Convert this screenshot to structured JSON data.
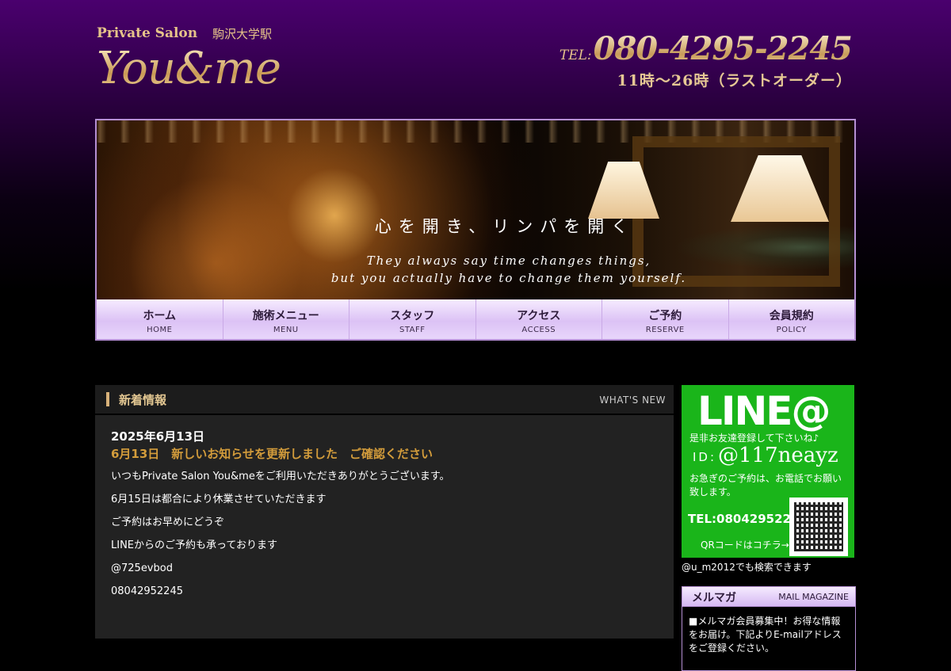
{
  "header": {
    "logo_small": "Private Salon",
    "logo_station": "駒沢大学駅",
    "logo_brand": "You&me",
    "tel_label": "TEL:",
    "tel_number": "080-4295-2245",
    "hours": "11時〜26時（ラストオーダー）"
  },
  "hero": {
    "headline": "心を開き、リンパを開く",
    "tagline_line1": "They always say time changes things,",
    "tagline_line2": "but you actually have to change them yourself."
  },
  "nav": [
    {
      "jp": "ホーム",
      "en": "HOME"
    },
    {
      "jp": "施術メニュー",
      "en": "MENU"
    },
    {
      "jp": "スタッフ",
      "en": "STAFF"
    },
    {
      "jp": "アクセス",
      "en": "ACCESS"
    },
    {
      "jp": "ご予約",
      "en": "RESERVE"
    },
    {
      "jp": "会員規約",
      "en": "POLICY"
    }
  ],
  "news": {
    "heading": "新着情報",
    "heading_en": "WHAT'S NEW",
    "date": "2025年6月13日",
    "title": "6月13日　新しいお知らせを更新しました　ご確認ください",
    "paragraphs": [
      "いつもPrivate Salon You&meをご利用いただきありがとうございます。",
      "6月15日は都合により休業させていただきます",
      "ご予約はお早めにどうぞ",
      "LINEからのご予約も承っております",
      "@725evbod",
      "08042952245"
    ]
  },
  "sidebar": {
    "line_logo": "LINE@",
    "line_sub": "是非お友達登録して下さいね♪",
    "line_id_label": "ID:",
    "line_id": "@117neayz",
    "line_note": "お急ぎのご予約は、お電話でお願い致します。",
    "line_tel": "TEL:08042952245",
    "line_qr_label": "QRコードはコチラ→",
    "caption": "@u_m2012でも検索できます",
    "mail_heading": "メルマガ",
    "mail_heading_en": "MAIL MAGAZINE",
    "mail_body": "■メルマガ会員募集中！お得な情報をお届け。下記よりE-mailアドレスをご登録ください。"
  }
}
